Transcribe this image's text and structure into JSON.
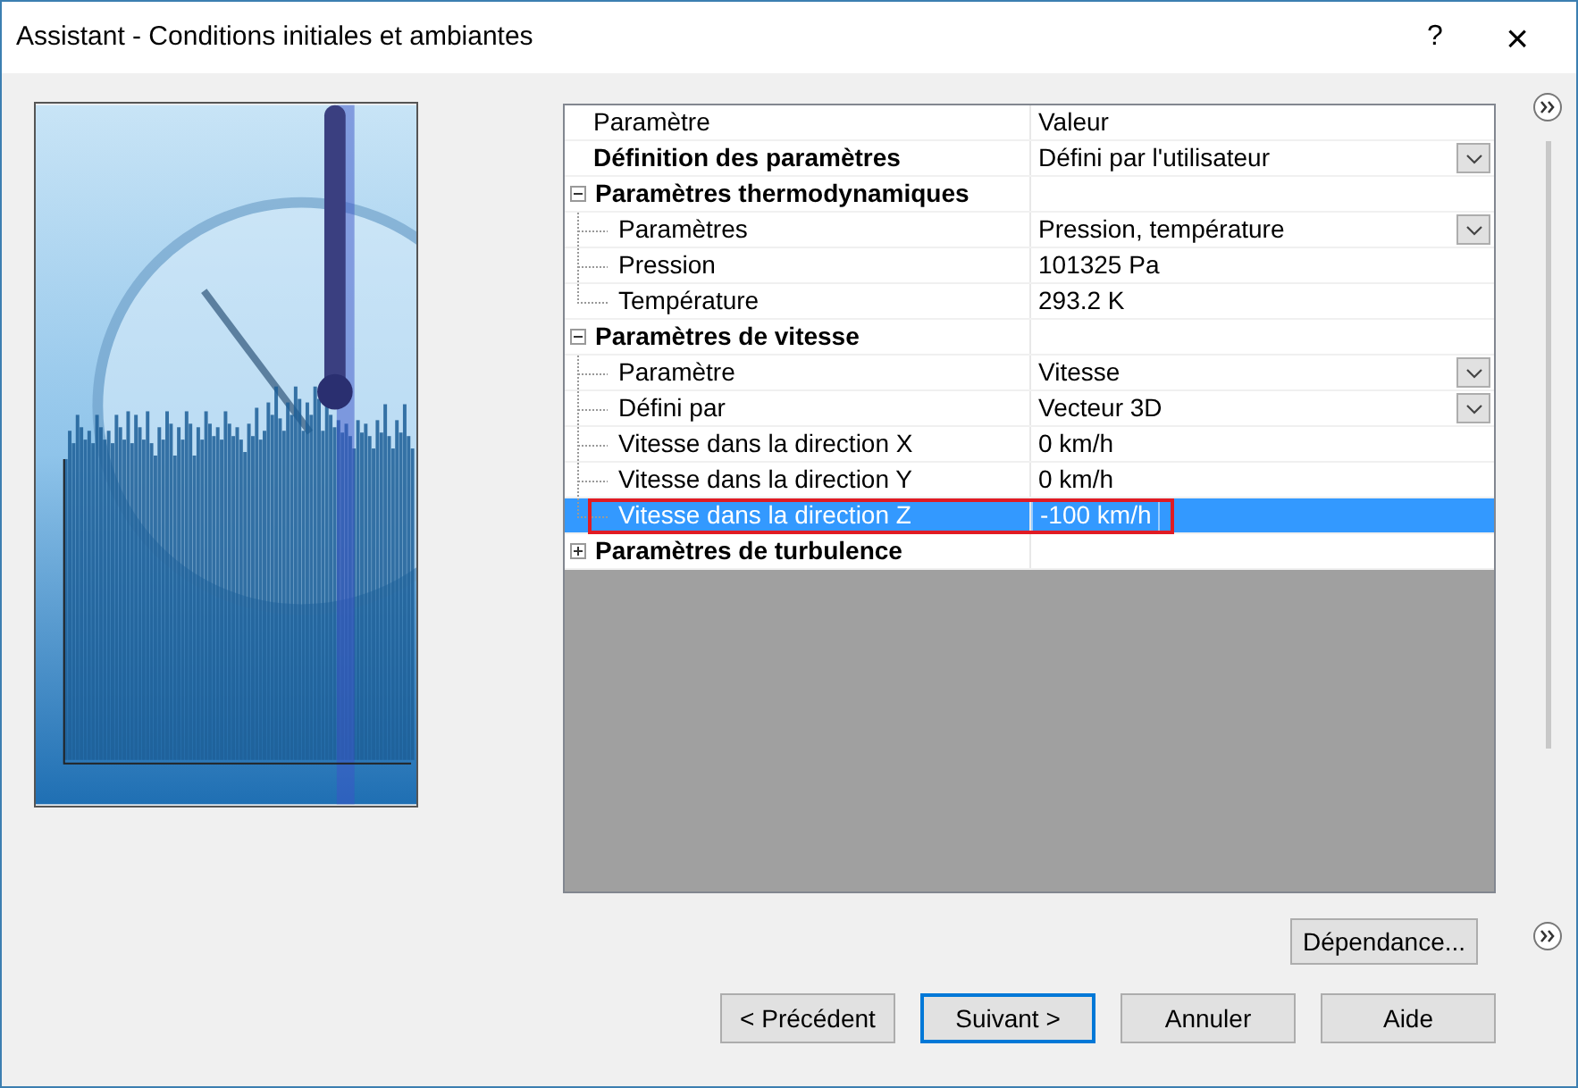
{
  "window": {
    "title": "Assistant - Conditions initiales et ambiantes",
    "help": "?",
    "close": "×"
  },
  "grid": {
    "columns": [
      "Paramètre",
      "Valeur"
    ],
    "rows": [
      {
        "kind": "property",
        "label": "Définition des paramètres",
        "value": "Défini par l'utilisateur",
        "bold": true,
        "dropdown": true,
        "selected": false,
        "outlined": false
      },
      {
        "kind": "group",
        "label": "Paramètres thermodynamiques",
        "expanded": true,
        "children": [
          {
            "kind": "property",
            "label": "Paramètres",
            "value": "Pression, température",
            "bold": false,
            "dropdown": true,
            "selected": false,
            "outlined": false
          },
          {
            "kind": "property",
            "label": "Pression",
            "value": "101325 Pa",
            "bold": false,
            "dropdown": false,
            "selected": false,
            "outlined": false
          },
          {
            "kind": "property",
            "label": "Température",
            "value": "293.2 K",
            "bold": false,
            "dropdown": false,
            "selected": false,
            "outlined": false
          }
        ]
      },
      {
        "kind": "group",
        "label": "Paramètres de vitesse",
        "expanded": true,
        "children": [
          {
            "kind": "property",
            "label": "Paramètre",
            "value": "Vitesse",
            "bold": false,
            "dropdown": true,
            "selected": false,
            "outlined": false
          },
          {
            "kind": "property",
            "label": "Défini par",
            "value": "Vecteur 3D",
            "bold": false,
            "dropdown": true,
            "selected": false,
            "outlined": false
          },
          {
            "kind": "property",
            "label": "Vitesse dans la direction X",
            "value": "0 km/h",
            "bold": false,
            "dropdown": false,
            "selected": false,
            "outlined": false
          },
          {
            "kind": "property",
            "label": "Vitesse dans la direction Y",
            "value": "0 km/h",
            "bold": false,
            "dropdown": false,
            "selected": false,
            "outlined": false
          },
          {
            "kind": "property",
            "label": "Vitesse dans la direction Z",
            "value": "-100 km/h",
            "bold": false,
            "dropdown": false,
            "selected": true,
            "outlined": true
          }
        ]
      },
      {
        "kind": "group",
        "label": "Paramètres de turbulence",
        "expanded": false,
        "children": []
      }
    ]
  },
  "dependency_button": "Dépendance...",
  "buttons": [
    {
      "label": "< Précédent",
      "selected": false
    },
    {
      "label": "Suivant >",
      "selected": true
    },
    {
      "label": "Annuler",
      "selected": false
    },
    {
      "label": "Aide",
      "selected": false
    }
  ]
}
